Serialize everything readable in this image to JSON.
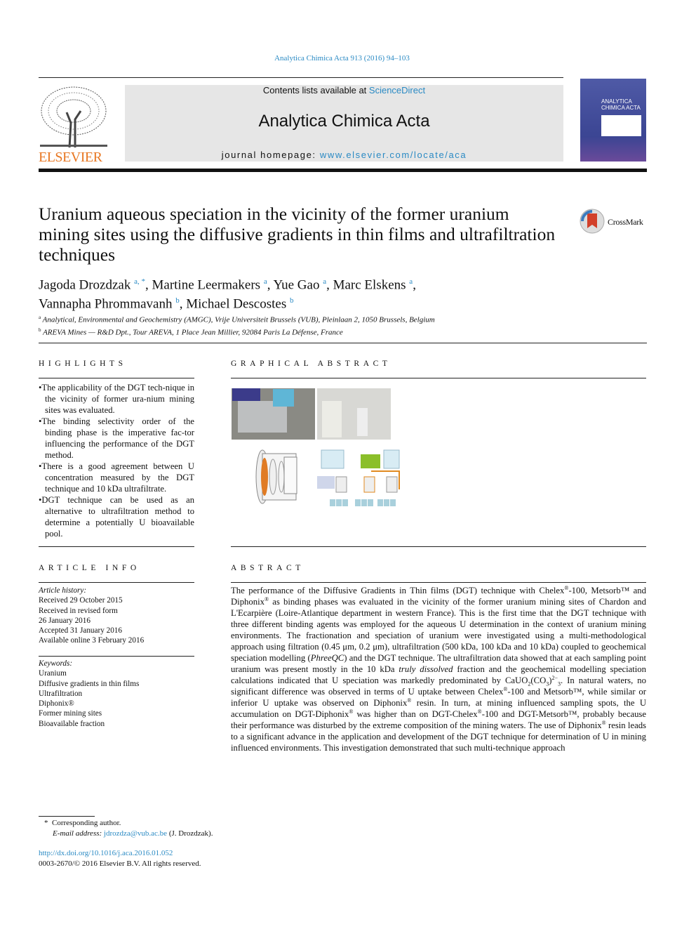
{
  "journal_citation": "Analytica Chimica Acta 913 (2016) 94–103",
  "banner": {
    "contents_prefix": "Contents lists available at ",
    "contents_link": "ScienceDirect",
    "journal_title": "Analytica Chimica Acta",
    "homepage_prefix": "journal homepage: ",
    "homepage_link": "www.elsevier.com/locate/aca"
  },
  "publisher_logo": "ELSEVIER",
  "cover_title": "ANALYTICA CHIMICA ACTA",
  "crossmark": "CrossMark",
  "article": {
    "title": "Uranium aqueous speciation in the vicinity of the former uranium mining sites using the diffusive gradients in thin films and ultrafiltration techniques",
    "authors": [
      {
        "name": "Jagoda Drozdzak",
        "sup": "a,",
        "star": " *",
        "sep": ", "
      },
      {
        "name": "Martine Leermakers",
        "sup": "a",
        "star": "",
        "sep": ", "
      },
      {
        "name": "Yue Gao",
        "sup": "a",
        "star": "",
        "sep": ", "
      },
      {
        "name": "Marc Elskens",
        "sup": "a",
        "star": "",
        "sep": ","
      },
      {
        "name": "Vannapha Phrommavanh",
        "sup": "b",
        "star": "",
        "sep": ", "
      },
      {
        "name": "Michael Descostes",
        "sup": "b",
        "star": "",
        "sep": ""
      }
    ],
    "affiliations": [
      {
        "sup": "a",
        "text": "Analytical, Environmental and Geochemistry (AMGC), Vrije Universiteit Brussels (VUB), Pleinlaan 2, 1050 Brussels, Belgium"
      },
      {
        "sup": "b",
        "text": "AREVA Mines — R&D Dpt., Tour AREVA, 1 Place Jean Millier, 92084 Paris La Défense, France"
      }
    ]
  },
  "highlights": {
    "heading": "HIGHLIGHTS",
    "items": [
      "The applicability of the DGT tech-nique in the vicinity of former ura-nium mining sites was evaluated.",
      "The binding selectivity order of the binding phase is the imperative fac-tor influencing the performance of the DGT method.",
      "There is a good agreement between U concentration measured by the DGT technique and 10 kDa ultrafiltrate.",
      "DGT technique can be used as an alternative to ultrafiltration method to determine a potentially U bioavailable pool."
    ]
  },
  "graphical_abstract": {
    "heading": "GRAPHICAL ABSTRACT"
  },
  "article_info": {
    "heading": "ARTICLE INFO",
    "history_label": "Article history:",
    "history": [
      "Received 29 October 2015",
      "Received in revised form",
      "26 January 2016",
      "Accepted 31 January 2016",
      "Available online 3 February 2016"
    ],
    "keywords_label": "Keywords:",
    "keywords": [
      "Uranium",
      "Diffusive gradients in thin films",
      "Ultrafiltration",
      "Diphonix®",
      "Former mining sites",
      "Bioavailable fraction"
    ]
  },
  "abstract": {
    "heading": "ABSTRACT",
    "segments": [
      {
        "t": "The performance of the Diffusive Gradients in Thin films (DGT) technique with Chelex"
      },
      {
        "t": "®",
        "s": "sup"
      },
      {
        "t": "-100, Metsorb™ and Diphonix"
      },
      {
        "t": "®",
        "s": "sup"
      },
      {
        "t": " as binding phases was evaluated in the vicinity of the former uranium mining sites of Chardon and L'Ecarpière (Loire-Atlantique department in western France). This is the first time that the DGT technique with three different binding agents was employed for the aqueous U determination in the context of uranium mining environments. The fractionation and speciation of uranium were investigated using a multi-methodological approach using filtration (0.45 μm, 0.2 μm), ultrafiltration (500 kDa, 100 kDa and 10 kDa) coupled to geochemical speciation modelling ("
      },
      {
        "t": "PhreeQC",
        "s": "i"
      },
      {
        "t": ") and the DGT technique. The ultrafiltration data showed that at each sampling point uranium was present mostly in the 10 kDa "
      },
      {
        "t": "truly dissolved",
        "s": "i"
      },
      {
        "t": " fraction and the geochemical modelling speciation calculations indicated that U speciation was markedly predominated by CaUO"
      },
      {
        "t": "2",
        "s": "sub"
      },
      {
        "t": "(CO"
      },
      {
        "t": "3",
        "s": "sub"
      },
      {
        "t": ")"
      },
      {
        "t": "2−",
        "s": "sup"
      },
      {
        "t": "3",
        "s": "sub"
      },
      {
        "t": ". In natural waters, no significant difference was observed in terms of U uptake between Chelex"
      },
      {
        "t": "®",
        "s": "sup"
      },
      {
        "t": "-100 and Metsorb™, while similar or inferior U uptake was observed on Diphonix"
      },
      {
        "t": "®",
        "s": "sup"
      },
      {
        "t": " resin. In turn, at mining influenced sampling spots, the U accumulation on DGT-Diphonix"
      },
      {
        "t": "®",
        "s": "sup"
      },
      {
        "t": " was higher than on DGT-Chelex"
      },
      {
        "t": "®",
        "s": "sup"
      },
      {
        "t": "-100 and DGT-Metsorb™, probably because their performance was disturbed by the extreme composition of the mining waters. The use of Diphonix"
      },
      {
        "t": "®",
        "s": "sup"
      },
      {
        "t": " resin leads to a significant advance in the application and development of the DGT technique for determination of U in mining influenced environments. This investigation demonstrated that such multi-technique approach"
      }
    ]
  },
  "footnote": {
    "star": "*",
    "corresponding": "Corresponding author.",
    "email_label": "E-mail address: ",
    "email": "jdrozdza@vub.ac.be",
    "email_suffix": " (J. Drozdzak).",
    "doi": "http://dx.doi.org/10.1016/j.aca.2016.01.052",
    "copyright": "0003-2670/© 2016 Elsevier B.V. All rights reserved."
  },
  "colors": {
    "link": "#2a8ac4",
    "elsevier": "#e87722",
    "banner_bg": "#e6e6e6"
  }
}
